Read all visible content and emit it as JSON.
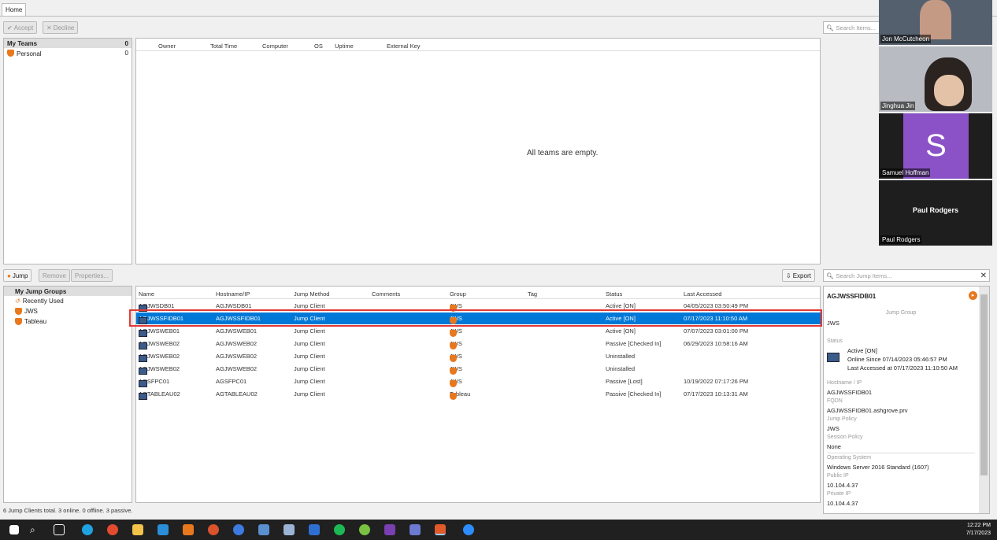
{
  "home_tab": "Home",
  "toolbar": {
    "accept": "Accept",
    "decline": "Decline"
  },
  "top_search_placeholder": "Search Items...",
  "teams": {
    "header_label": "My Teams",
    "header_count": "0",
    "items": [
      {
        "label": "Personal",
        "count": "0"
      }
    ]
  },
  "teams_table": {
    "columns": [
      "Owner",
      "Total Time",
      "Computer",
      "OS",
      "Uptime",
      "External Key"
    ],
    "empty_message": "All teams are empty."
  },
  "jump_toolbar": {
    "jump": "Jump",
    "remove": "Remove",
    "properties": "Properties...",
    "export": "Export",
    "search_placeholder": "Search Jump Items..."
  },
  "jump_groups": {
    "header": "My Jump Groups",
    "items": [
      "Recently Used",
      "JWS",
      "Tableau"
    ]
  },
  "jump_table": {
    "columns": [
      "Name",
      "Hostname/IP",
      "Jump Method",
      "Comments",
      "Group",
      "Tag",
      "Status",
      "Last Accessed"
    ],
    "rows": [
      {
        "name": "AGJWSDB01",
        "host": "AGJWSDB01",
        "method": "Jump Client",
        "group": "JWS",
        "status": "Active [ON]",
        "last": "04/05/2023 03:50:49 PM"
      },
      {
        "name": "AGJWSSFIDB01",
        "host": "AGJWSSFIDB01",
        "method": "Jump Client",
        "group": "JWS",
        "status": "Active [ON]",
        "last": "07/17/2023 11:10:50 AM"
      },
      {
        "name": "AGJWSWEB01",
        "host": "AGJWSWEB01",
        "method": "Jump Client",
        "group": "JWS",
        "status": "Active [ON]",
        "last": "07/07/2023 03:01:00 PM"
      },
      {
        "name": "AGJWSWEB02",
        "host": "AGJWSWEB02",
        "method": "Jump Client",
        "group": "JWS",
        "status": "Passive [Checked In]",
        "last": "06/29/2023 10:58:16 AM"
      },
      {
        "name": "AGJWSWEB02",
        "host": "AGJWSWEB02",
        "method": "Jump Client",
        "group": "JWS",
        "status": "Uninstalled",
        "last": ""
      },
      {
        "name": "AGJWSWEB02",
        "host": "AGJWSWEB02",
        "method": "Jump Client",
        "group": "JWS",
        "status": "Uninstalled",
        "last": ""
      },
      {
        "name": "AGSFPC01",
        "host": "AGSFPC01",
        "method": "Jump Client",
        "group": "JWS",
        "status": "Passive [Lost]",
        "last": "10/19/2022 07:17:26 PM"
      },
      {
        "name": "AGTABLEAU02",
        "host": "AGTABLEAU02",
        "method": "Jump Client",
        "group": "Tableau",
        "status": "Passive [Checked In]",
        "last": "07/17/2023 10:13:31 AM"
      }
    ]
  },
  "details": {
    "title": "AGJWSSFIDB01",
    "jump_group_label": "Jump Group",
    "jump_group_value": "JWS",
    "status_label": "Status",
    "status_value": "Active [ON]",
    "online_since": "Online Since 07/14/2023 05:46:57 PM",
    "last_accessed": "Last Accessed at 07/17/2023 11:10:50 AM",
    "hostname_label": "Hostname / IP",
    "hostname_value": "AGJWSSFIDB01",
    "fqdn_label": "FQDN",
    "fqdn_value": "AGJWSSFIDB01.ashgrove.prv",
    "policy_label": "Jump Policy",
    "policy_value": "JWS",
    "session_label": "Session Policy",
    "session_value": "None",
    "os_label": "Operating System",
    "os_value": "Windows Server 2016 Standard (1607)",
    "public_ip_label": "Public IP",
    "public_ip_value": "10.104.4.37",
    "private_ip_label": "Private IP",
    "private_ip_value": "10.104.4.37"
  },
  "status_bar": "6 Jump Clients total.  3 online.  0 offline.  3 passive.",
  "video": {
    "p1": "Jon McCutcheon",
    "p2": "Jinghua Jin",
    "p3_initial": "S",
    "p3": "Samuel Hoffman",
    "p4_center": "Paul Rodgers",
    "p4": "Paul Rodgers"
  },
  "clock": {
    "time": "12:22 PM",
    "date": "7/17/2023"
  }
}
